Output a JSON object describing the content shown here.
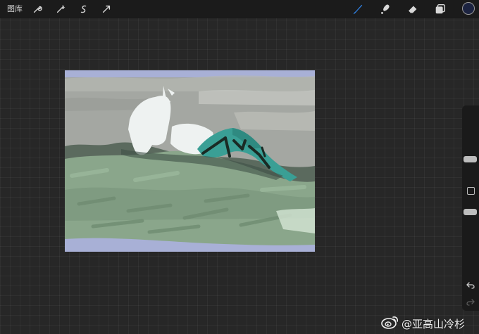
{
  "toolbar": {
    "gallery_label": "图库",
    "left_tools": [
      "wrench-icon",
      "adjustments-icon",
      "selection-icon",
      "transform-icon"
    ],
    "right_tools": [
      "brush-icon",
      "smudge-icon",
      "eraser-icon",
      "layers-icon"
    ],
    "current_color": "#1c2340",
    "brush_active_color": "#2f7fe0"
  },
  "sidebar": {
    "controls": [
      "brush-size-slider",
      "modify-button",
      "opacity-slider",
      "undo-icon",
      "redo-icon"
    ]
  },
  "artwork": {
    "palette": {
      "sky": "#a7aaa4",
      "band": "#a8b0d6",
      "grass": "#8aa68b",
      "grass_dark": "#5f7a62",
      "figure": "#eef2f1",
      "jeans": "#3a9f95",
      "outline": "#1a2a24"
    }
  },
  "watermark": {
    "text": "@亚高山冷杉"
  }
}
